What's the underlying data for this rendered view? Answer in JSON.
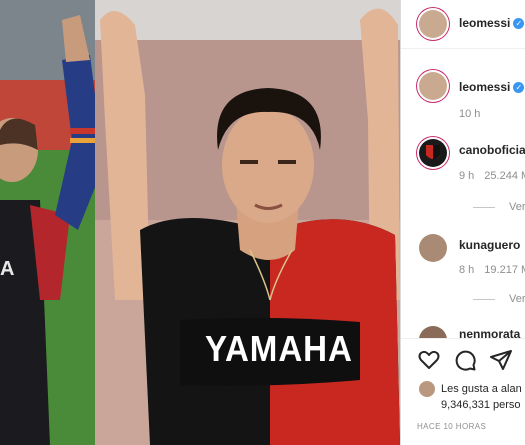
{
  "header": {
    "username": "leomessi"
  },
  "caption": {
    "username": "leomessi",
    "time": "10 h"
  },
  "comments": [
    {
      "username": "canoboficia",
      "time": "9 h",
      "likes": "25.244 M",
      "reply": "Ver re"
    },
    {
      "username": "kunaguero",
      "time": "8 h",
      "likes": "19.217 M",
      "reply": "Ver re"
    },
    {
      "username": "nenmorata"
    }
  ],
  "actions": {
    "like_icon": "heart-icon",
    "comment_icon": "comment-icon",
    "share_icon": "share-icon"
  },
  "likes": {
    "liked_by": "Les gusta a alan",
    "count": "9,346,331 perso"
  },
  "timestamp": "HACE 10 HORAS",
  "photo_text": {
    "jersey": "YAMAHA"
  },
  "colors": {
    "verified": "#3897f0",
    "newells_red": "#c8281f",
    "text": "#262626",
    "muted": "#8e8e8e"
  }
}
